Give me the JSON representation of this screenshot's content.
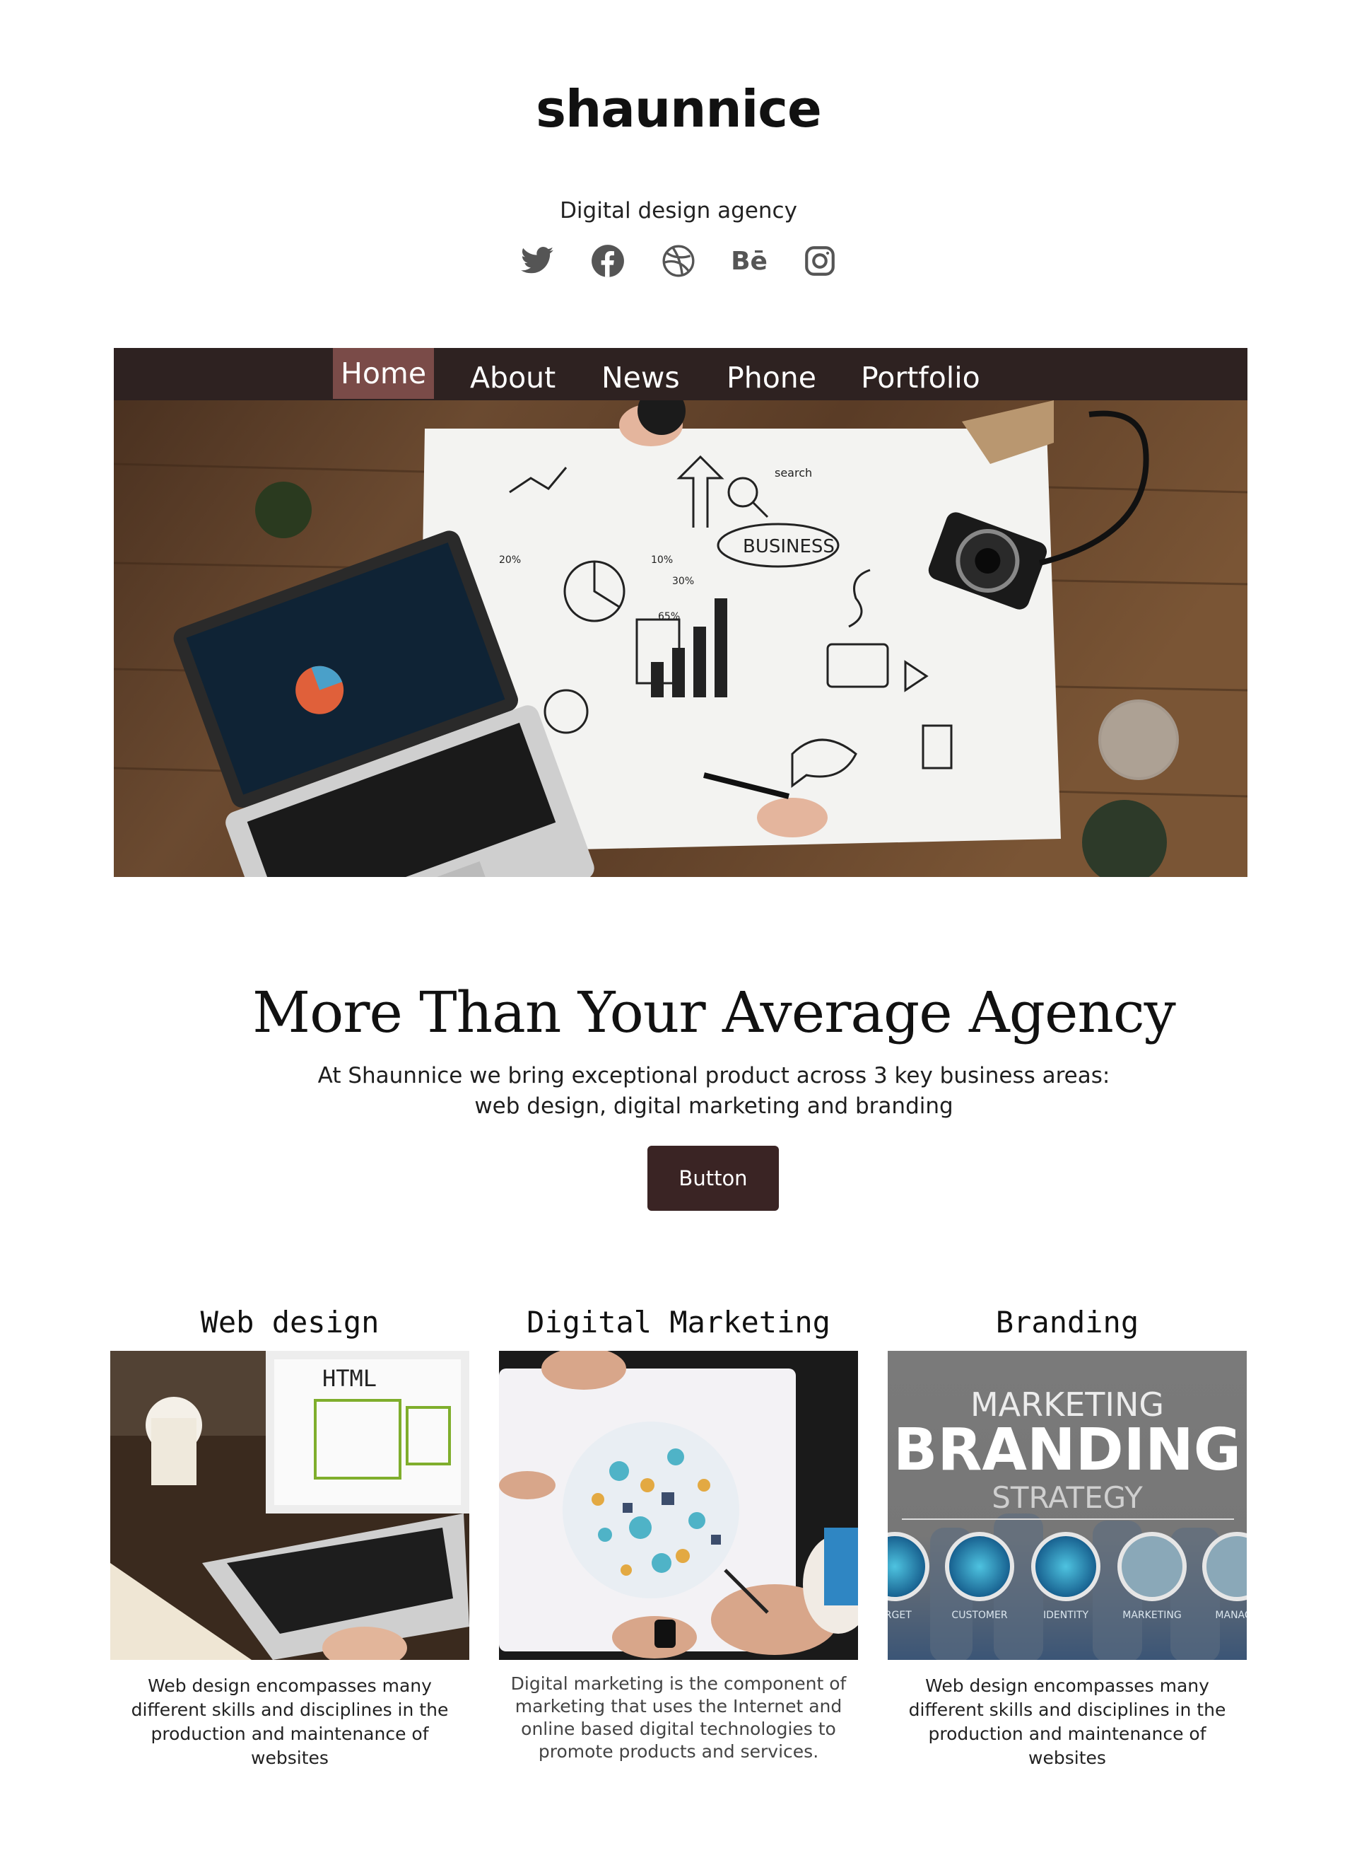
{
  "brand": {
    "logo": "shaunnice",
    "tagline": "Digital design agency"
  },
  "social": [
    "twitter-icon",
    "facebook-icon",
    "dribbble-icon",
    "behance-icon",
    "instagram-icon"
  ],
  "social_labels": {
    "behance": "Bē"
  },
  "nav": {
    "items": [
      {
        "label": "Home",
        "active": true
      },
      {
        "label": "About"
      },
      {
        "label": "News"
      },
      {
        "label": "Phone"
      },
      {
        "label": "Portfolio"
      }
    ]
  },
  "hero": {
    "sketch_labels": {
      "business": "BUSINESS",
      "search": "search",
      "p20": "20%",
      "p10": "10%",
      "p30": "30%",
      "p65": "65%"
    }
  },
  "main": {
    "headline": "More Than Your Average Agency",
    "intro": "At Shaunnice we bring exceptional product across 3 key business areas: web design, digital marketing and branding",
    "button_label": "Button"
  },
  "services": [
    {
      "title": "Web design",
      "img_label": "HTML",
      "text": "Web design encompasses many different skills and disciplines in the production and maintenance of websites"
    },
    {
      "title": "Digital Marketing",
      "text": "Digital marketing is the component of marketing that uses the Internet and online based digital technologies  to promote products and services."
    },
    {
      "title": "Branding",
      "img_text": {
        "l1": "MARKETING",
        "l2": "BRANDING",
        "l3": "STRATEGY",
        "icons": [
          "ARGET",
          "CUSTOMER",
          "IDENTITY",
          "MARKETING",
          "MANAGE"
        ]
      },
      "text": "Web design encompasses many different skills and disciplines in the production and maintenance of websites"
    }
  ],
  "colors": {
    "nav_bg": "#2e2221",
    "nav_active": "#7a4b48",
    "button_bg": "#3a2424",
    "icon": "#555555"
  }
}
